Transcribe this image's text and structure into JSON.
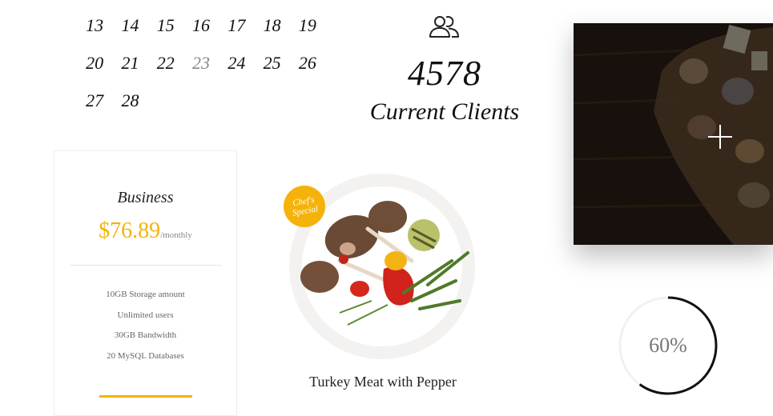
{
  "calendar": {
    "rows": [
      [
        "13",
        "14",
        "15",
        "16",
        "17",
        "18",
        "19"
      ],
      [
        "20",
        "21",
        "22",
        "23",
        "24",
        "25",
        "26"
      ],
      [
        "27",
        "28"
      ]
    ],
    "muted_day": "23"
  },
  "counter": {
    "icon": "users-icon",
    "number": "4578",
    "label": "Current Clients"
  },
  "image_card": {
    "icon": "plus-icon"
  },
  "pricing": {
    "plan": "Business",
    "price": "$76.89",
    "period": "/monthly",
    "features": [
      "10GB Storage amount",
      "Unlimited users",
      "30GB Bandwidth",
      "20 MySQL Databases"
    ],
    "accent": "#f5b20a"
  },
  "dish": {
    "badge": "Chef's Special",
    "title": "Turkey Meat with Pepper"
  },
  "progress": {
    "label": "60%",
    "value": 0.6
  }
}
